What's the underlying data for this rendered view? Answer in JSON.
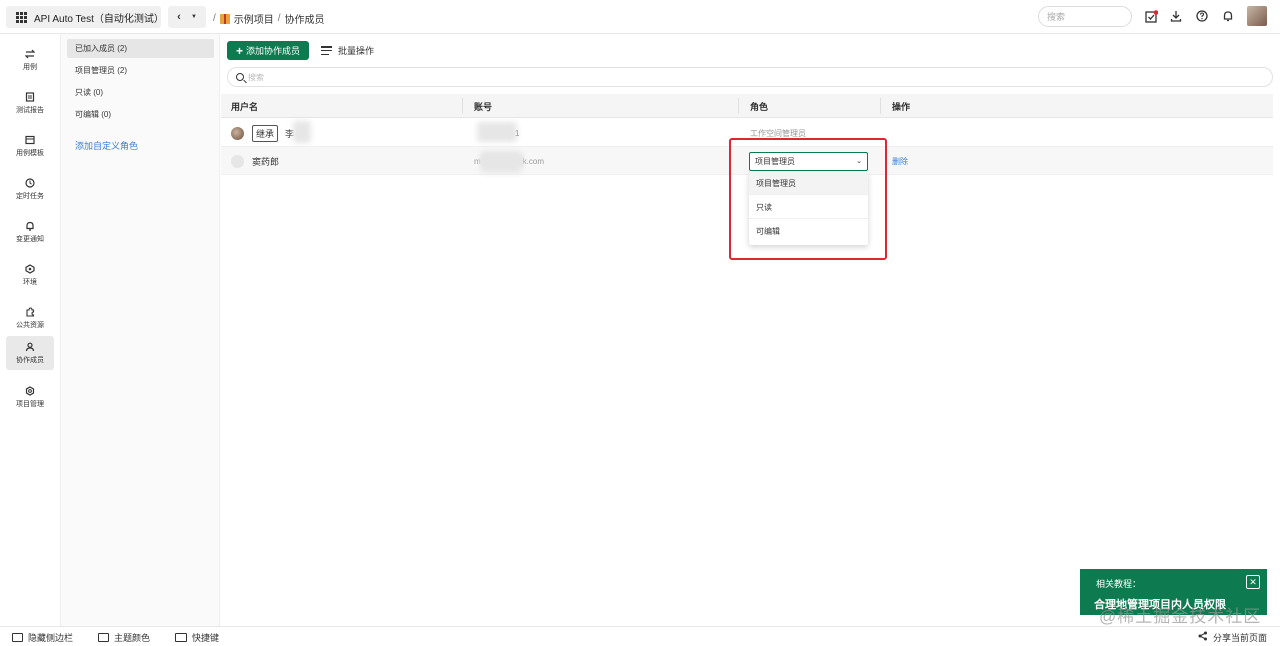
{
  "topbar": {
    "workspace_label": "API Auto Test（自动化测试）",
    "breadcrumb": {
      "sep": "/",
      "project": "示例项目",
      "page": "协作成员"
    },
    "search_placeholder": "搜索"
  },
  "rail": {
    "items": [
      {
        "label": "用例",
        "icon": "swap-icon"
      },
      {
        "label": "测试报告",
        "icon": "report-icon"
      },
      {
        "label": "用例模板",
        "icon": "template-icon"
      },
      {
        "label": "定时任务",
        "icon": "clock-icon"
      },
      {
        "label": "变更通知",
        "icon": "bell-icon"
      },
      {
        "label": "环境",
        "icon": "environment-icon"
      },
      {
        "label": "公共资源",
        "icon": "puzzle-icon"
      },
      {
        "label": "协作成员",
        "icon": "member-icon"
      },
      {
        "label": "项目管理",
        "icon": "settings-icon"
      }
    ]
  },
  "subside": {
    "items": [
      {
        "label": "已加入成员 (2)"
      },
      {
        "label": "项目管理员 (2)"
      },
      {
        "label": "只读 (0)"
      },
      {
        "label": "可编辑 (0)"
      }
    ],
    "add_role": "添加自定义角色"
  },
  "toolbar": {
    "add_member": "添加协作成员",
    "batch": "批量操作",
    "search_placeholder": "搜索"
  },
  "table": {
    "headers": [
      "用户名",
      "账号",
      "角色",
      "操作"
    ],
    "rows": [
      {
        "tag": "继承",
        "name": "李",
        "account": "1",
        "role": "工作空间管理员"
      },
      {
        "name": "窦药郎",
        "account_prefix": "m",
        "account_suffix": "k.com",
        "role": "项目管理员",
        "action": "删除"
      }
    ]
  },
  "role_dropdown": {
    "selected": "项目管理员",
    "options": [
      "项目管理员",
      "只读",
      "可编辑"
    ]
  },
  "bottombar": {
    "hide_sidebar": "隐藏侧边栏",
    "theme": "主题颜色",
    "shortcuts": "快捷键",
    "share": "分享当前页面"
  },
  "tutorial": {
    "label": "相关教程：",
    "title": "合理地管理项目内人员权限"
  },
  "watermark": "@稀土掘金技术社区",
  "colors": {
    "primary": "#0d7a4f",
    "link": "#3b7ed6",
    "highlight": "#e0262e"
  }
}
